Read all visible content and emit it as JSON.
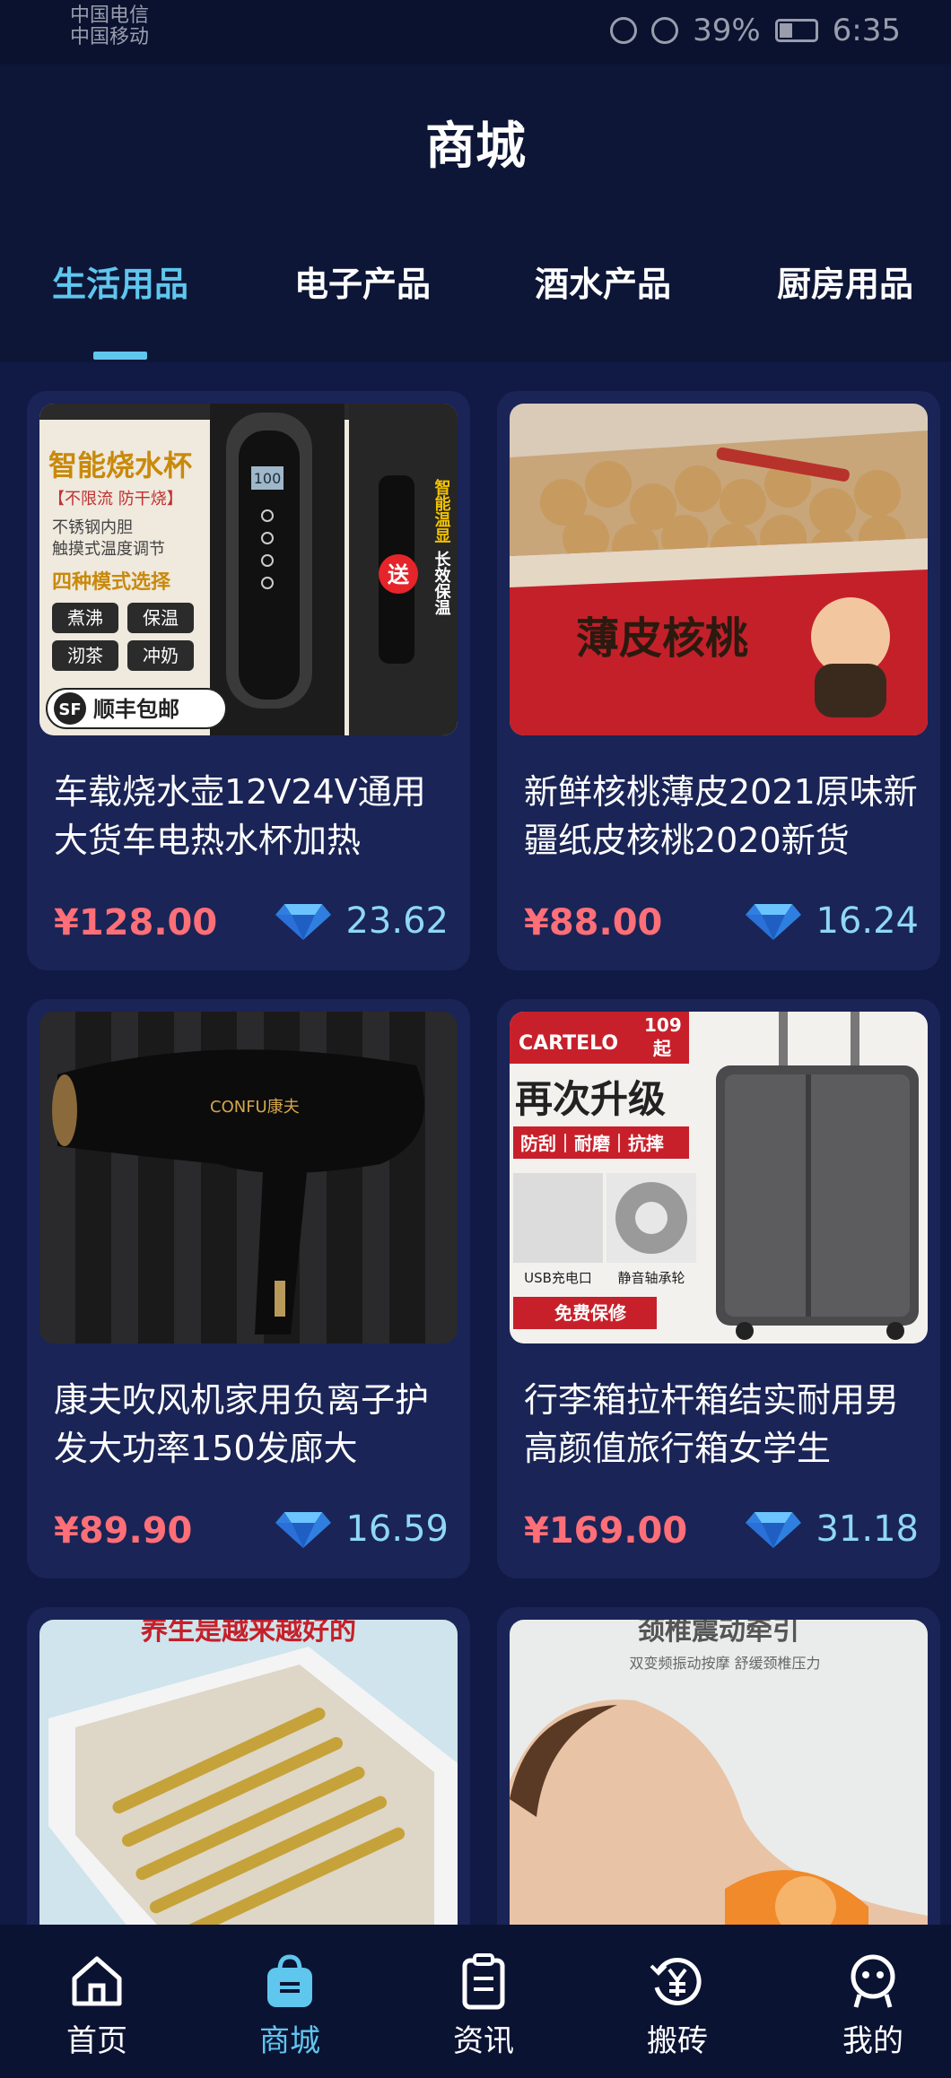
{
  "status_bar": {
    "carrier_1": "中国电信",
    "carrier_2": "中国移动",
    "battery": "39%",
    "time": "6:35"
  },
  "header": {
    "title": "商城"
  },
  "tabs": [
    {
      "label": "生活用品",
      "active": true
    },
    {
      "label": "电子产品",
      "active": false
    },
    {
      "label": "酒水产品",
      "active": false
    },
    {
      "label": "厨房用品",
      "active": false
    }
  ],
  "products": [
    {
      "name": "车载烧水壶12V24V通用大货车电热水杯加热",
      "price": "¥128.00",
      "gems": "23.62",
      "image_text": {
        "headline": "智能烧水杯",
        "tag": "【不限流 防干烧】",
        "line1": "不锈钢内胆",
        "line2": "触摸式温度调节",
        "modes_title": "四种模式选择",
        "mode1": "煮沸",
        "mode2": "保温",
        "mode3": "沏茶",
        "mode4": "冲奶",
        "ship": "顺丰包邮",
        "gift": "送",
        "side": "智能温显",
        "side2": "长效保温",
        "display": "100"
      }
    },
    {
      "name": "新鲜核桃薄皮2021原味新疆纸皮核桃2020新货",
      "price": "¥88.00",
      "gems": "16.24",
      "image_text": {
        "box": "薄皮核桃"
      }
    },
    {
      "name": "康夫吹风机家用负离子护发大功率150发廊大",
      "price": "¥89.90",
      "gems": "16.59",
      "image_text": {
        "brand": "CONFU康夫"
      }
    },
    {
      "name": "行李箱拉杆箱结实耐用男高颜值旅行箱女学生",
      "price": "¥169.00",
      "gems": "31.18",
      "image_text": {
        "brand": "CARTELO",
        "price_tag": "109",
        "from": "起",
        "headline": "再次升级",
        "features": "防刮｜耐磨｜抗摔",
        "usb": "USB充电口",
        "wheel": "静音轴承轮",
        "warranty": "免费保修"
      }
    },
    {
      "name": "",
      "price": "",
      "gems": "",
      "image_text": {
        "banner": "养生是越来越好的"
      }
    },
    {
      "name": "",
      "price": "",
      "gems": "",
      "image_text": {
        "headline": "颈椎震动牵引",
        "sub": "双变频振动按摩 舒缓颈椎压力"
      }
    }
  ],
  "bottom_nav": [
    {
      "label": "首页",
      "icon": "home-icon",
      "active": false
    },
    {
      "label": "商城",
      "icon": "shopping-bag-icon",
      "active": true
    },
    {
      "label": "资讯",
      "icon": "clipboard-icon",
      "active": false
    },
    {
      "label": "搬砖",
      "icon": "yuan-coin-icon",
      "active": false
    },
    {
      "label": "我的",
      "icon": "profile-face-icon",
      "active": false
    }
  ],
  "colors": {
    "background": "#0d1636",
    "card": "#1a2456",
    "accent": "#5fc6ee",
    "price": "#ff6f78",
    "gem_text": "#8fd7f7"
  }
}
